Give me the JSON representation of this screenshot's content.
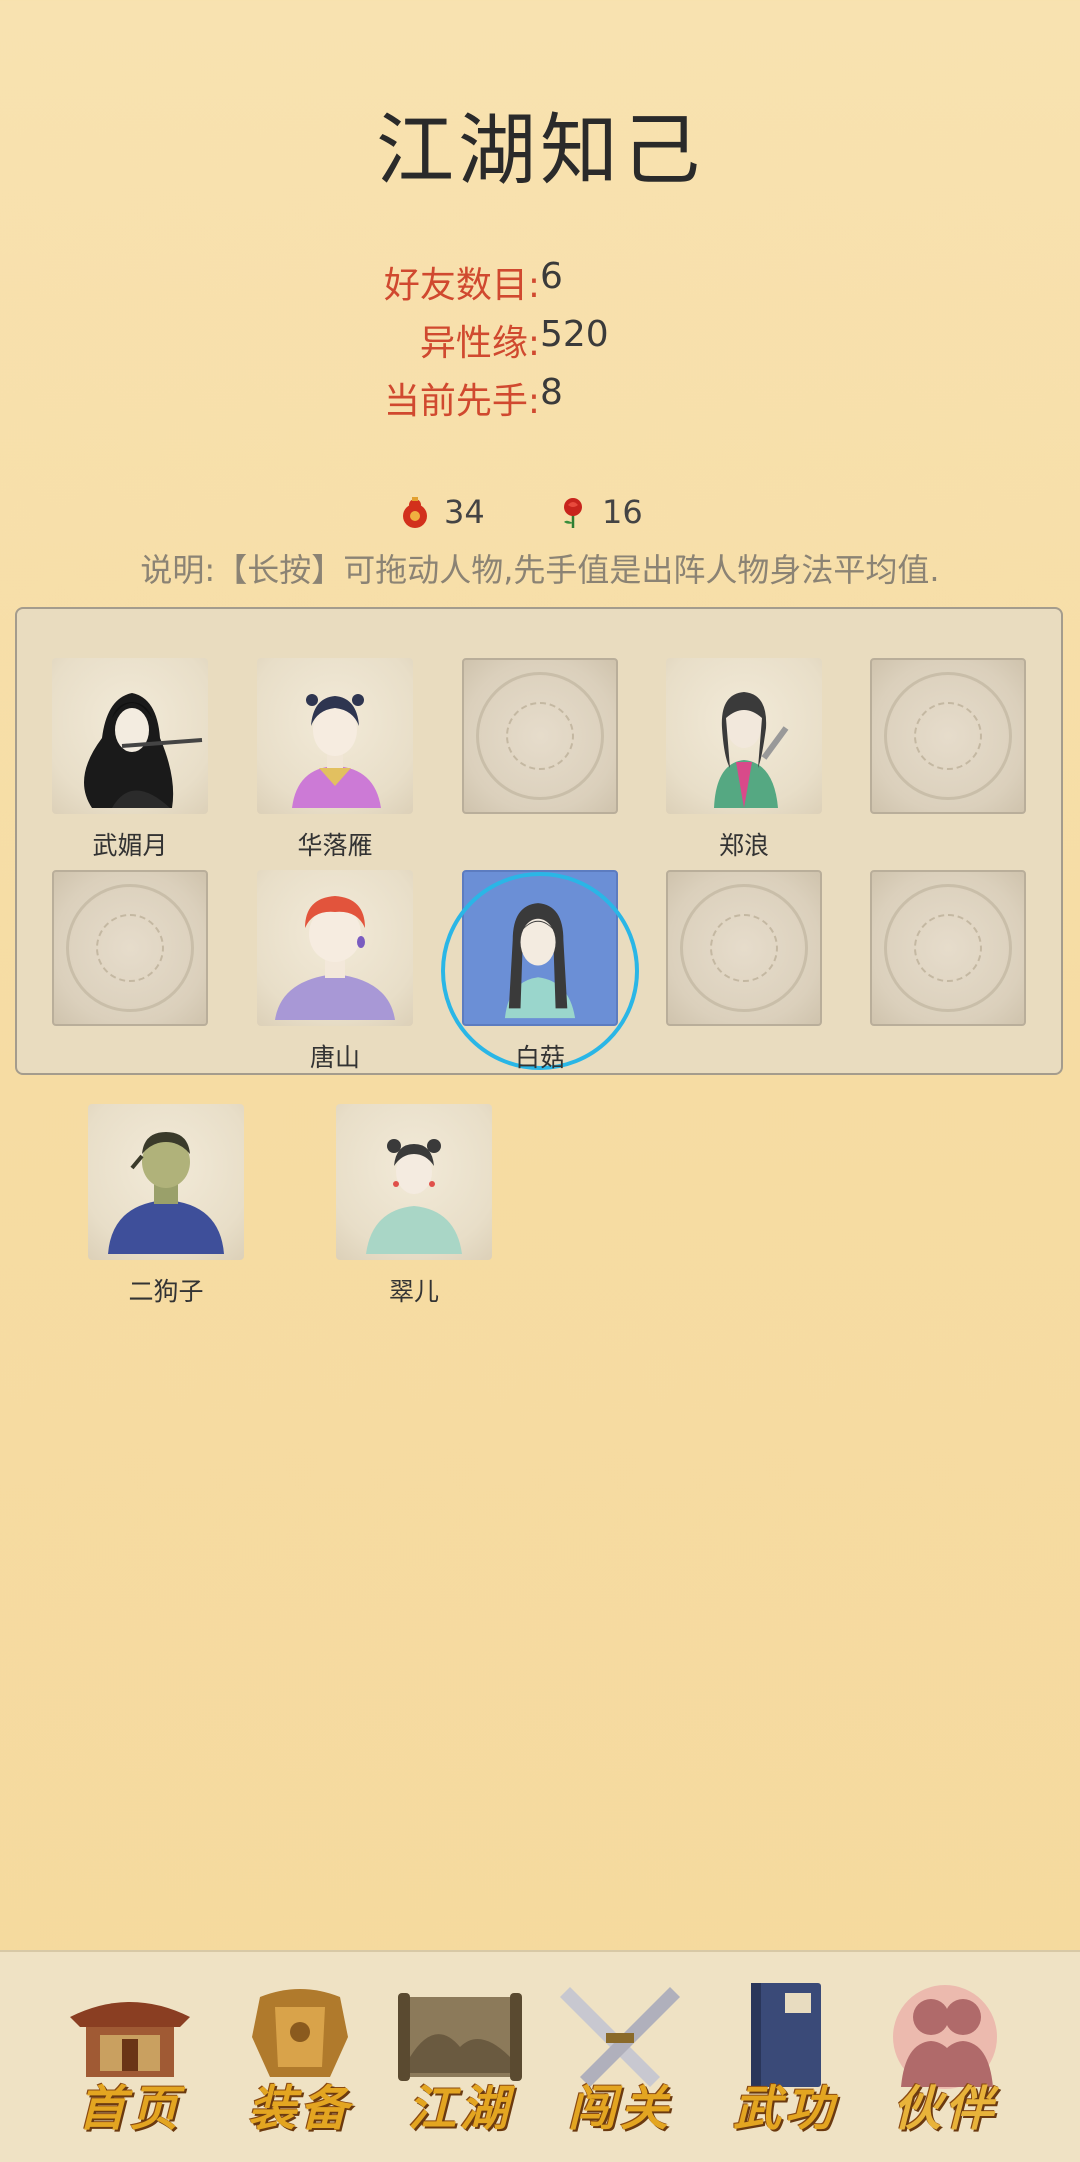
{
  "title": "江湖知己",
  "stats": [
    {
      "label": "好友数目:",
      "value": "6"
    },
    {
      "label": "异性缘:",
      "value": "520"
    },
    {
      "label": "当前先手:",
      "value": "8"
    }
  ],
  "currencies": [
    {
      "icon": "gourd-icon",
      "value": "34",
      "color": "#d2301c"
    },
    {
      "icon": "rose-icon",
      "value": "16",
      "color": "#c8241c"
    }
  ],
  "note": "说明:【长按】可拖动人物,先手值是出阵人物身法平均值.",
  "formation": {
    "row1": [
      {
        "name": "武媚月",
        "empty": false
      },
      {
        "name": "华落雁",
        "empty": false
      },
      {
        "name": "",
        "empty": true
      },
      {
        "name": "郑浪",
        "empty": false
      },
      {
        "name": "",
        "empty": true
      }
    ],
    "row2": [
      {
        "name": "",
        "empty": true
      },
      {
        "name": "唐山",
        "empty": false
      },
      {
        "name": "白菇",
        "empty": false,
        "selected": true
      },
      {
        "name": "",
        "empty": true
      },
      {
        "name": "",
        "empty": true
      }
    ]
  },
  "reserve": [
    {
      "name": "二狗子"
    },
    {
      "name": "翠儿"
    }
  ],
  "nav": [
    {
      "label": "首页",
      "icon": "pavilion-icon"
    },
    {
      "label": "装备",
      "icon": "armor-icon"
    },
    {
      "label": "江湖",
      "icon": "scroll-map-icon"
    },
    {
      "label": "闯关",
      "icon": "crossed-swords-icon"
    },
    {
      "label": "武功",
      "icon": "book-icon"
    },
    {
      "label": "伙伴",
      "icon": "partners-icon",
      "active": true
    }
  ]
}
